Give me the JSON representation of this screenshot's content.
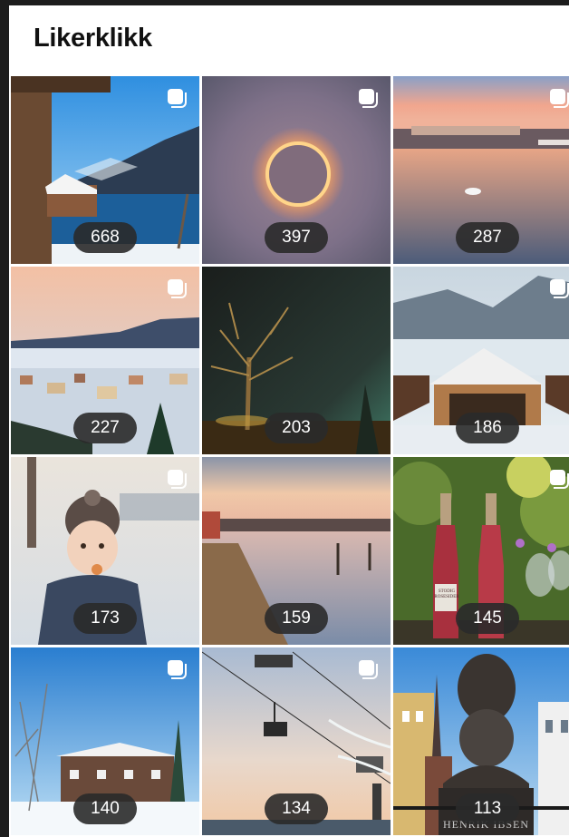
{
  "header": {
    "title": "Likerklikk"
  },
  "grid": {
    "items": [
      {
        "likes": "668",
        "icon": "multiple-images-icon"
      },
      {
        "likes": "397",
        "icon": "multiple-images-icon"
      },
      {
        "likes": "287",
        "icon": "multiple-images-icon"
      },
      {
        "likes": "227",
        "icon": "multiple-images-icon"
      },
      {
        "likes": "203",
        "icon": "multiple-images-icon"
      },
      {
        "likes": "186",
        "icon": "multiple-images-icon"
      },
      {
        "likes": "173",
        "icon": "multiple-images-icon"
      },
      {
        "likes": "159",
        "icon": "multiple-images-icon"
      },
      {
        "likes": "145",
        "icon": "multiple-images-icon"
      },
      {
        "likes": "140",
        "icon": "multiple-images-icon"
      },
      {
        "likes": "134",
        "icon": "multiple-images-icon"
      },
      {
        "likes": "113",
        "icon": "multiple-images-icon"
      }
    ]
  },
  "photo_texts": {
    "bottle_label": "STODIG ROSESIDER",
    "statue_plaque": "HENRIK IBSEN"
  }
}
